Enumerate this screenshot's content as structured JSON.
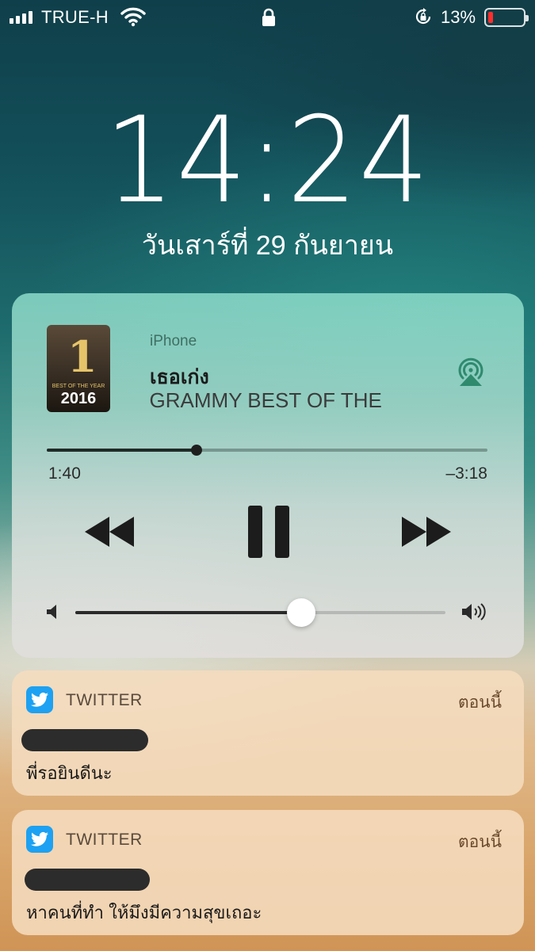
{
  "status_bar": {
    "carrier": "TRUE-H",
    "battery_percent": "13%",
    "battery_level": 0.13,
    "battery_color": "#ff2d2d"
  },
  "lock_screen": {
    "time": "14:24",
    "date": "วันเสาร์ที่ 29 กันยายน"
  },
  "now_playing": {
    "device": "iPhone",
    "song_title": "เธอเก่ง",
    "artist_line": "MM GRAMMY BEST OF THE",
    "album_art_number": "1",
    "album_art_subtitle": "BEST OF THE YEAR",
    "album_art_year": "2016",
    "elapsed": "1:40",
    "remaining": "–3:18",
    "progress_fraction": 0.34,
    "volume_fraction": 0.61
  },
  "notifications": [
    {
      "app": "TWITTER",
      "time_label": "ตอนนี้",
      "message": "พี่รอยินดีนะ",
      "icon": "twitter-bird-icon",
      "icon_color": "#1da1f2"
    },
    {
      "app": "TWITTER",
      "time_label": "ตอนนี้",
      "message": "หาคนที่ทำ ให้มึงมีความสุขเถอะ",
      "icon": "twitter-bird-icon",
      "icon_color": "#1da1f2"
    }
  ]
}
